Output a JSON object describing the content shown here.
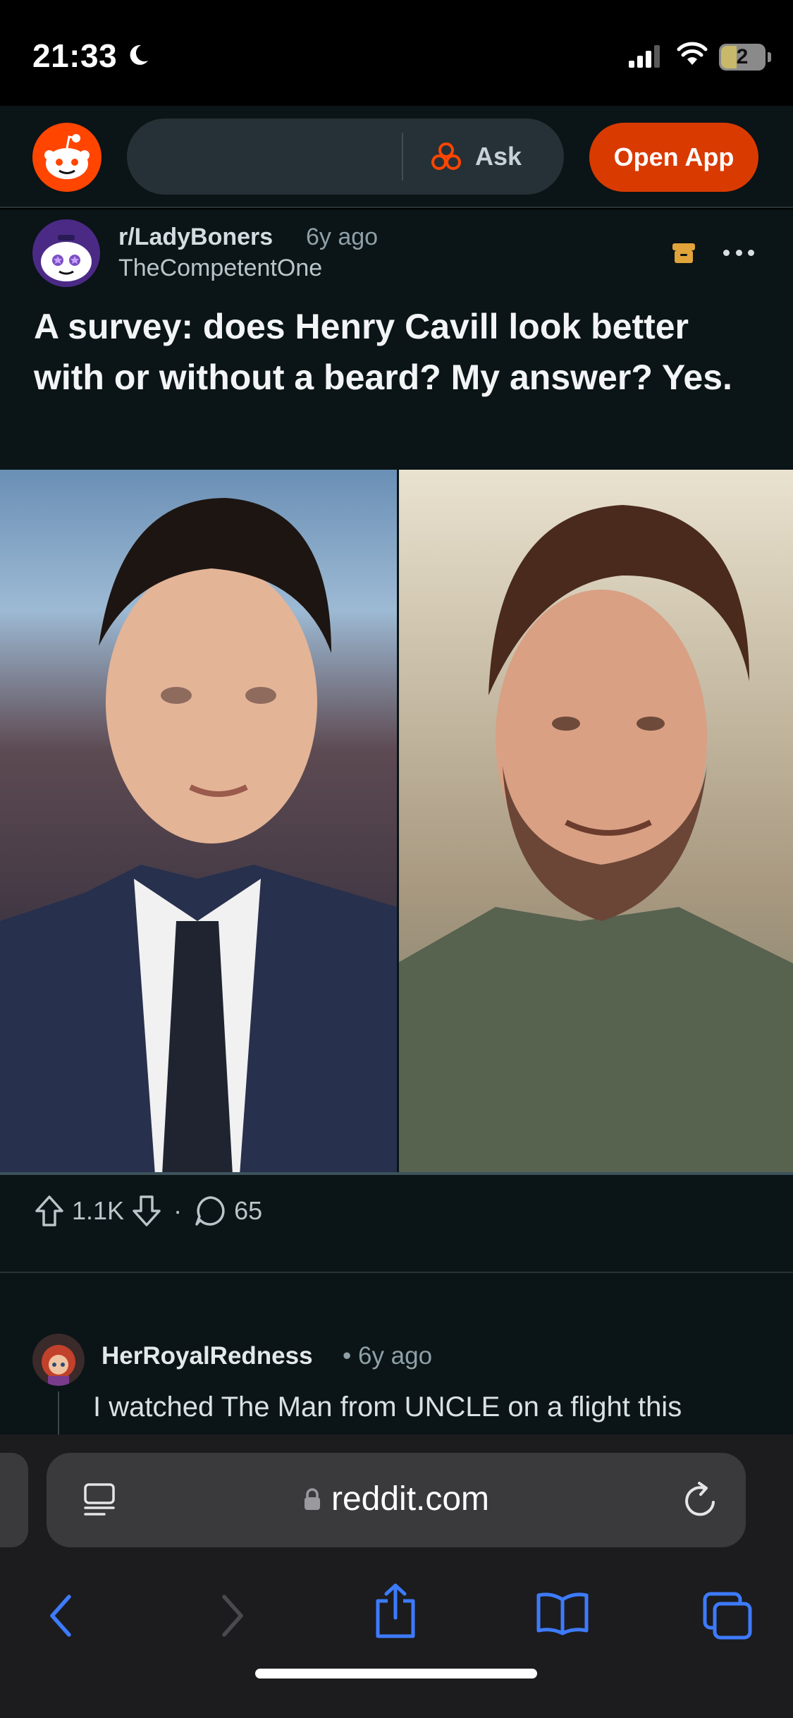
{
  "status_bar": {
    "time": "21:33",
    "battery_level": "2",
    "icons": [
      "moon-icon",
      "signal-icon",
      "wifi-icon",
      "battery-icon"
    ]
  },
  "header": {
    "search_placeholder": "",
    "ask_label": "Ask",
    "open_app_label": "Open App",
    "accent": "#d93a00"
  },
  "post": {
    "subreddit": "r/LadyBoners",
    "age": "6y ago",
    "author": "TheCompetentOne",
    "title": "A survey: does Henry Cavill look better with or without a beard? My answer? Yes.",
    "upvotes": "1.1K",
    "separator": "·",
    "comments": "65"
  },
  "comment": {
    "author": "HerRoyalRedness",
    "meta": "• 6y ago",
    "text": "I watched The Man from UNCLE on a flight this"
  },
  "browser": {
    "url": "reddit.com",
    "icons": [
      "reader-icon",
      "lock-icon",
      "reload-icon",
      "back-icon",
      "forward-icon",
      "share-icon",
      "bookmarks-icon",
      "tabs-icon"
    ]
  }
}
